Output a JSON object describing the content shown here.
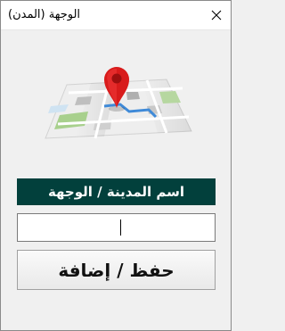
{
  "window": {
    "title": "الوجهة (المدن)",
    "close_icon": "close-icon"
  },
  "illustration": {
    "icon": "map-location-pin-icon",
    "colors": {
      "pin": "#d81b1b",
      "map": "#e9e9e9"
    }
  },
  "form": {
    "city_label": "اسم المدينة / الوجهة",
    "city_input_value": "",
    "save_button_label": "حفظ / إضافة"
  },
  "colors": {
    "label_background": "#02403c",
    "label_text": "#ffffff"
  }
}
